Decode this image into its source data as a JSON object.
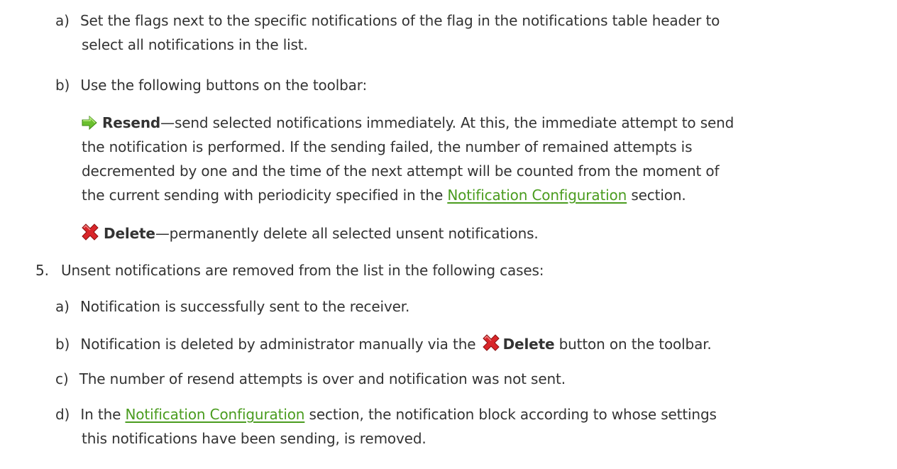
{
  "items": {
    "a1": {
      "label": "a)",
      "line1": "Set the flags next to the specific notifications of the flag in the notifications table header to",
      "line2": "select all notifications in the list."
    },
    "b1": {
      "label": "b)",
      "line1": "Use the following buttons on the toolbar:"
    },
    "resend": {
      "icon": "green-arrow-icon",
      "title": "Resend",
      "line1": "—send selected notifications immediately. At this, the immediate attempt to send",
      "line2": "the notification is performed. If the sending failed, the number of remained attempts is",
      "line3": "decremented by one and the time of the next attempt will be counted from the moment of",
      "line4_before": "the current sending with periodicity specified in the ",
      "line4_link": "Notification Configuration",
      "line4_after": " section."
    },
    "delete": {
      "icon": "red-x-icon",
      "title": "Delete",
      "line1": "—permanently delete all selected unsent notifications."
    },
    "step5": {
      "label": "5.",
      "line1": "Unsent notifications are removed from the list in the following cases:"
    },
    "a2": {
      "label": "a)",
      "line1": "Notification is successfully sent to the receiver."
    },
    "b2": {
      "label": "b)",
      "line1_before": "Notification is deleted by administrator manually via the ",
      "line1_button": "Delete",
      "line1_after": " button on the toolbar."
    },
    "c2": {
      "label": "c)",
      "line1": "The number of resend attempts is over and notification was not sent."
    },
    "d2": {
      "label": "d)",
      "line1_before": "In the ",
      "line1_link": "Notification Configuration",
      "line1_after": " section, the notification block according to whose settings",
      "line2": "this notifications have been sending, is removed."
    }
  },
  "colors": {
    "text": "#333333",
    "link": "#4a9c1f",
    "arrow": "#6abf2e",
    "delete": "#d9262a"
  }
}
